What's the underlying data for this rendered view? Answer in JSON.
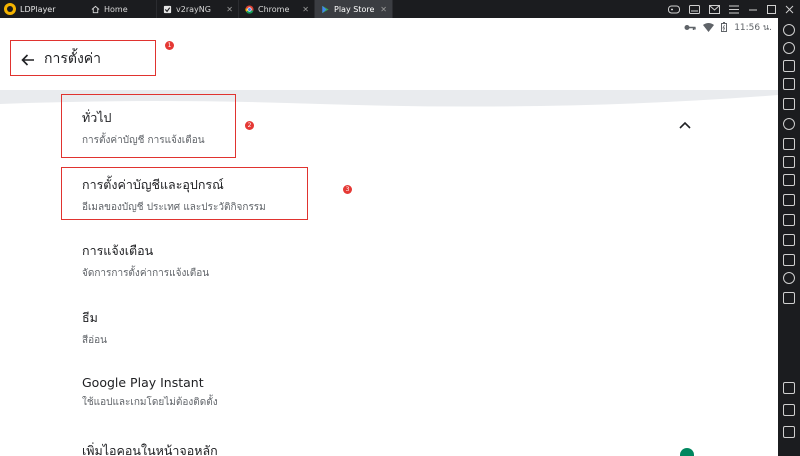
{
  "emulator": {
    "app_name": "LDPlayer",
    "tabs": [
      {
        "label": "Home",
        "icon": "home-icon",
        "closable": false,
        "active": false
      },
      {
        "label": "v2rayNG",
        "icon": "app-icon",
        "closable": true,
        "active": false
      },
      {
        "label": "Chrome",
        "icon": "chrome-icon",
        "closable": true,
        "active": false
      },
      {
        "label": "Play Store",
        "icon": "play-store-icon",
        "closable": true,
        "active": true
      }
    ],
    "window_controls": [
      "gamepad-icon",
      "keyboard-icon",
      "mail-icon",
      "menu-icon",
      "minimize-icon",
      "maximize-icon",
      "close-icon"
    ]
  },
  "status_bar": {
    "time": "11:56 น.",
    "icons": [
      "vpn-key-icon",
      "wifi-icon",
      "battery-icon"
    ]
  },
  "app_bar": {
    "title": "การตั้งค่า"
  },
  "annotations": [
    "1",
    "2",
    "3"
  ],
  "settings": [
    {
      "title": "ทั่วไป",
      "subtitle": "การตั้งค่าบัญชี การแจ้งเตือน"
    },
    {
      "title": "การตั้งค่าบัญชีและอุปกรณ์",
      "subtitle": "อีเมลของบัญชี ประเทศ และประวัติกิจกรรม"
    },
    {
      "title": "การแจ้งเตือน",
      "subtitle": "จัดการการตั้งค่าการแจ้งเตือน"
    },
    {
      "title": "ธีม",
      "subtitle": "สีอ่อน"
    },
    {
      "title": "Google Play Instant",
      "subtitle": "ใช้แอปและเกมโดยไม่ต้องติดตั้ง"
    },
    {
      "title": "เพิ่มไอคอนในหน้าจอหลัก",
      "subtitle": ""
    }
  ],
  "colors": {
    "highlight": "#e0332f",
    "accent_green": "#01875f",
    "emulator_chrome": "#1b1c1f"
  }
}
